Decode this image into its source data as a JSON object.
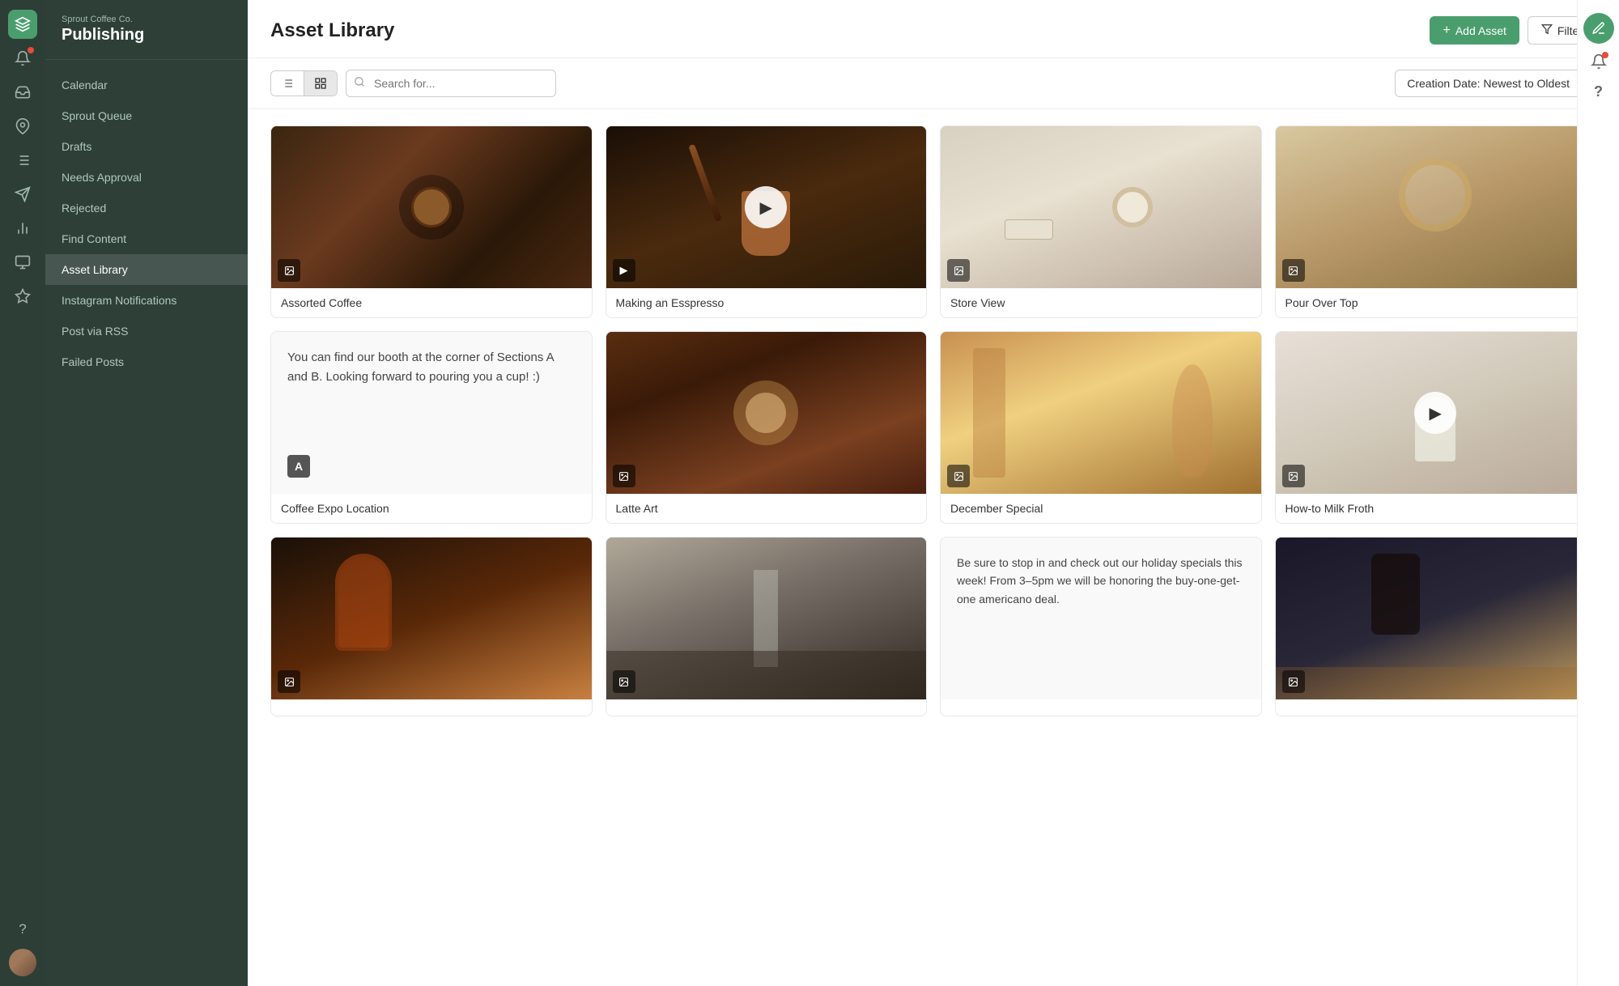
{
  "brand": {
    "sub": "Sprout Coffee Co.",
    "title": "Publishing"
  },
  "sidebar": {
    "items": [
      {
        "id": "calendar",
        "label": "Calendar",
        "active": false
      },
      {
        "id": "sprout-queue",
        "label": "Sprout Queue",
        "active": false
      },
      {
        "id": "drafts",
        "label": "Drafts",
        "active": false
      },
      {
        "id": "needs-approval",
        "label": "Needs Approval",
        "active": false
      },
      {
        "id": "rejected",
        "label": "Rejected",
        "active": false
      },
      {
        "id": "find-content",
        "label": "Find Content",
        "active": false
      },
      {
        "id": "asset-library",
        "label": "Asset Library",
        "active": true
      },
      {
        "id": "instagram-notifications",
        "label": "Instagram Notifications",
        "active": false
      },
      {
        "id": "post-via-rss",
        "label": "Post via RSS",
        "active": false
      },
      {
        "id": "failed-posts",
        "label": "Failed Posts",
        "active": false
      }
    ]
  },
  "header": {
    "title": "Asset Library",
    "add_asset_label": "Add Asset",
    "filter_label": "Filter"
  },
  "toolbar": {
    "search_placeholder": "Search for...",
    "sort_label": "Creation Date: Newest to Oldest"
  },
  "assets": [
    {
      "id": 1,
      "title": "Assorted Coffee",
      "type": "image",
      "has_play": false,
      "text": null
    },
    {
      "id": 2,
      "title": "Making an Esspresso",
      "type": "video",
      "has_play": true,
      "text": null
    },
    {
      "id": 3,
      "title": "Store View",
      "type": "image",
      "has_play": false,
      "text": null
    },
    {
      "id": 4,
      "title": "Pour Over Top",
      "type": "image",
      "has_play": false,
      "text": null
    },
    {
      "id": 5,
      "title": "Coffee Expo Location",
      "type": "text",
      "has_play": false,
      "text": "You can find our booth at the corner of Sections A and B. Looking forward to pouring you a cup! :)"
    },
    {
      "id": 6,
      "title": "Latte Art",
      "type": "image",
      "has_play": false,
      "text": null
    },
    {
      "id": 7,
      "title": "December Special",
      "type": "image",
      "has_play": false,
      "text": null
    },
    {
      "id": 8,
      "title": "How-to Milk Froth",
      "type": "video",
      "has_play": true,
      "text": null
    },
    {
      "id": 9,
      "title": "",
      "type": "image",
      "has_play": false,
      "text": null
    },
    {
      "id": 10,
      "title": "",
      "type": "image",
      "has_play": false,
      "text": null
    },
    {
      "id": 11,
      "title": "",
      "type": "text",
      "has_play": false,
      "text": "Be sure to stop in and check out our holiday specials this week! From 3–5pm we will be honoring the buy-one-get-one americano deal."
    },
    {
      "id": 12,
      "title": "",
      "type": "image",
      "has_play": false,
      "text": null
    }
  ]
}
